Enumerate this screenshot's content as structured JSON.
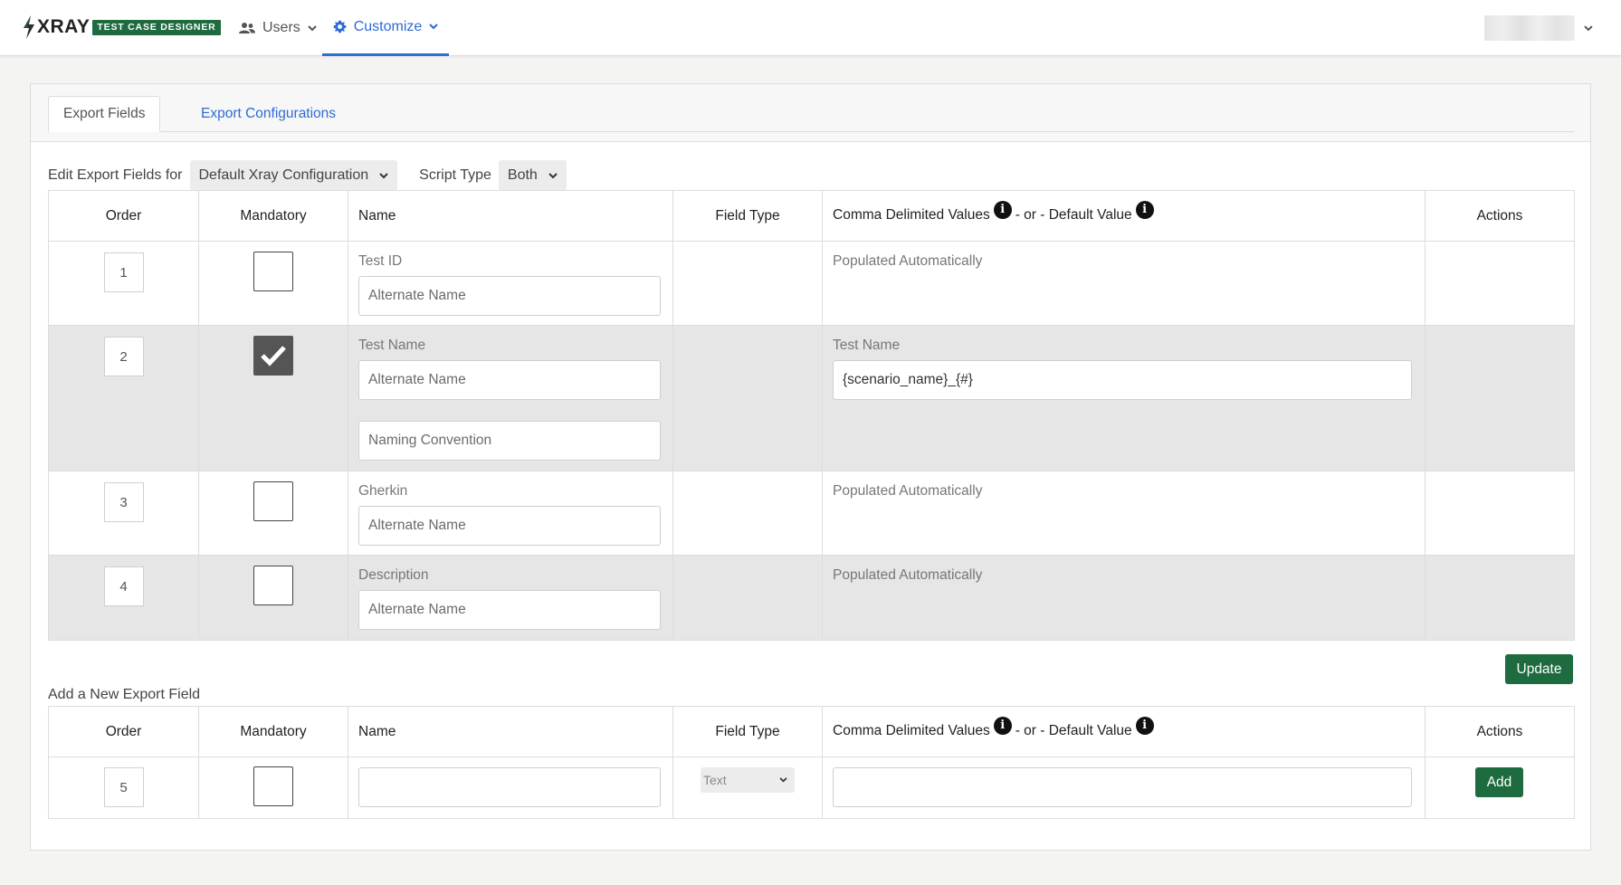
{
  "app": {
    "logo_text": "XRAY",
    "logo_badge": "TEST CASE DESIGNER"
  },
  "nav": {
    "users_label": "Users",
    "customize_label": "Customize"
  },
  "tabs": {
    "export_fields": "Export Fields",
    "export_configurations": "Export Configurations"
  },
  "filters": {
    "edit_label": "Edit Export Fields for",
    "configuration_value": "Default Xray Configuration",
    "script_type_label": "Script Type",
    "script_type_value": "Both"
  },
  "table": {
    "headers": {
      "order": "Order",
      "mandatory": "Mandatory",
      "name": "Name",
      "field_type": "Field Type",
      "values_1": "Comma Delimited Values",
      "values_2": "- or - Default Value",
      "actions": "Actions",
      "info": "i"
    },
    "rows": [
      {
        "order": "1",
        "mandatory": false,
        "name": "Test ID",
        "alt_placeholder": "Alternate Name",
        "value_text": "Populated Automatically"
      },
      {
        "order": "2",
        "mandatory": true,
        "name": "Test Name",
        "alt_placeholder": "Alternate Name",
        "naming_placeholder": "Naming Convention",
        "value_label": "Test Name",
        "value_input": "{scenario_name}_{#}"
      },
      {
        "order": "3",
        "mandatory": false,
        "name": "Gherkin",
        "alt_placeholder": "Alternate Name",
        "value_text": "Populated Automatically"
      },
      {
        "order": "4",
        "mandatory": false,
        "name": "Description",
        "alt_placeholder": "Alternate Name",
        "value_text": "Populated Automatically"
      }
    ]
  },
  "update_button": "Update",
  "new_field": {
    "title": "Add a New Export Field",
    "order": "5",
    "mandatory": false,
    "field_type_value": "Text",
    "add_button": "Add"
  },
  "colors": {
    "accent_blue": "#2e6bd4",
    "brand_green": "#1e6b3f",
    "shaded_row": "#e6e6e6"
  }
}
